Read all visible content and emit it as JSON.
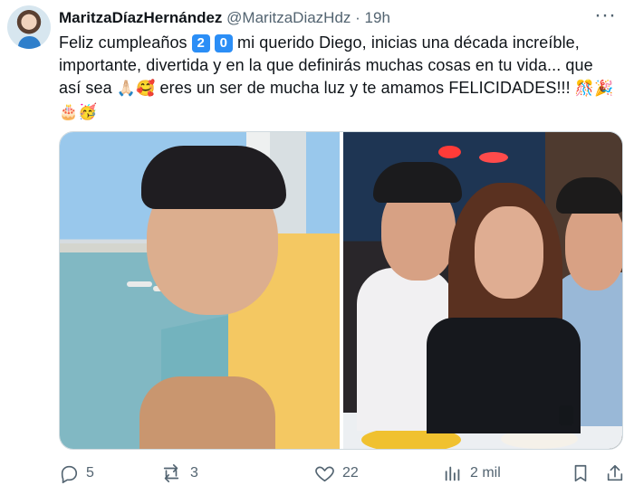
{
  "post": {
    "author_name": "MaritzaDíazHernández",
    "handle": "@MaritzaDiazHdz",
    "separator": "·",
    "time": "19h",
    "more_label": "···",
    "text": {
      "part1": "Feliz cumpleaños ",
      "digit1": "2",
      "digit2": "0",
      "part2": " mi querido Diego, inicias una década increíble, importante, divertida y en la que definirás muchas cosas en tu vida... que así sea ",
      "emoji1": "🙏🏻🥰",
      "part3": " eres un ser de mucha luz y te amamos FELICIDADES!!! ",
      "emoji2": "🎊🎉",
      "emoji3": "🎂🥳"
    }
  },
  "actions": {
    "replies": "5",
    "reposts": "3",
    "likes": "22",
    "views": "2 mil"
  },
  "icons": {
    "reply": "reply-icon",
    "repost": "repost-icon",
    "like": "heart-icon",
    "views": "views-icon",
    "bookmark": "bookmark-icon",
    "share": "share-icon"
  }
}
